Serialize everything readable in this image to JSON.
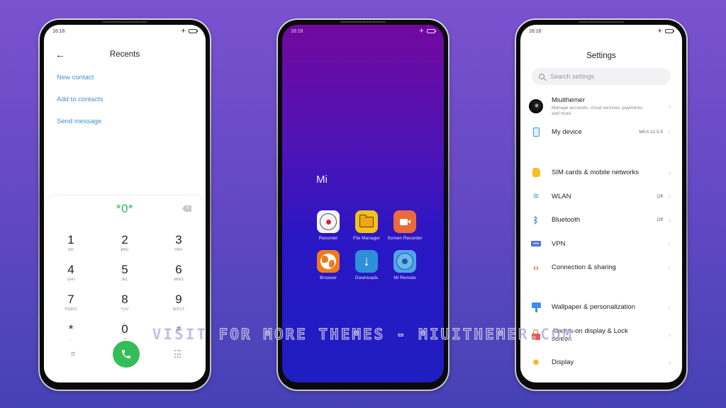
{
  "watermark": "VISIT FOR MORE THEMES - MIUITHEMER.COM",
  "status": {
    "time": "16:16"
  },
  "dialer": {
    "title": "Recents",
    "links": [
      "New contact",
      "Add to contacts",
      "Send message"
    ],
    "number": "*0*",
    "keys": [
      {
        "digit": "1",
        "letters": "QD"
      },
      {
        "digit": "2",
        "letters": "ABC"
      },
      {
        "digit": "3",
        "letters": "DEF"
      },
      {
        "digit": "4",
        "letters": "GHI"
      },
      {
        "digit": "5",
        "letters": "JKL"
      },
      {
        "digit": "6",
        "letters": "MNO"
      },
      {
        "digit": "7",
        "letters": "PQRS"
      },
      {
        "digit": "8",
        "letters": "TUV"
      },
      {
        "digit": "9",
        "letters": "WXYZ"
      },
      {
        "digit": "*",
        "letters": ","
      },
      {
        "digit": "0",
        "letters": "+"
      },
      {
        "digit": "#",
        "letters": ""
      }
    ],
    "call_color": "#35bd5a"
  },
  "home": {
    "folder_title": "Mi",
    "apps": [
      {
        "name": "Recorder",
        "label": "Recorder"
      },
      {
        "name": "File Manager",
        "label": "File Manager"
      },
      {
        "name": "Screen Recorder",
        "label": "Screen Recorder"
      },
      {
        "name": "Browser",
        "label": "Browser"
      },
      {
        "name": "Downloads",
        "label": "Downloads"
      },
      {
        "name": "Mi Remote",
        "label": "Mi Remote"
      }
    ]
  },
  "settings": {
    "title": "Settings",
    "search_placeholder": "Search settings",
    "account": {
      "name": "Miuithemer",
      "subtitle": "Manage accounts, cloud services, payments, and more"
    },
    "my_device": {
      "label": "My device",
      "value": "MIUI 12.5.5"
    },
    "group1": [
      {
        "label": "SIM cards & mobile networks",
        "value": ""
      },
      {
        "label": "WLAN",
        "value": "Off"
      },
      {
        "label": "Bluetooth",
        "value": "Off"
      },
      {
        "label": "VPN",
        "value": ""
      },
      {
        "label": "Connection & sharing",
        "value": ""
      }
    ],
    "group2": [
      {
        "label": "Wallpaper & personalization",
        "value": ""
      },
      {
        "label": "Always-on display & Lock screen",
        "value": ""
      },
      {
        "label": "Display",
        "value": ""
      }
    ],
    "vpn_badge": "VPN"
  }
}
